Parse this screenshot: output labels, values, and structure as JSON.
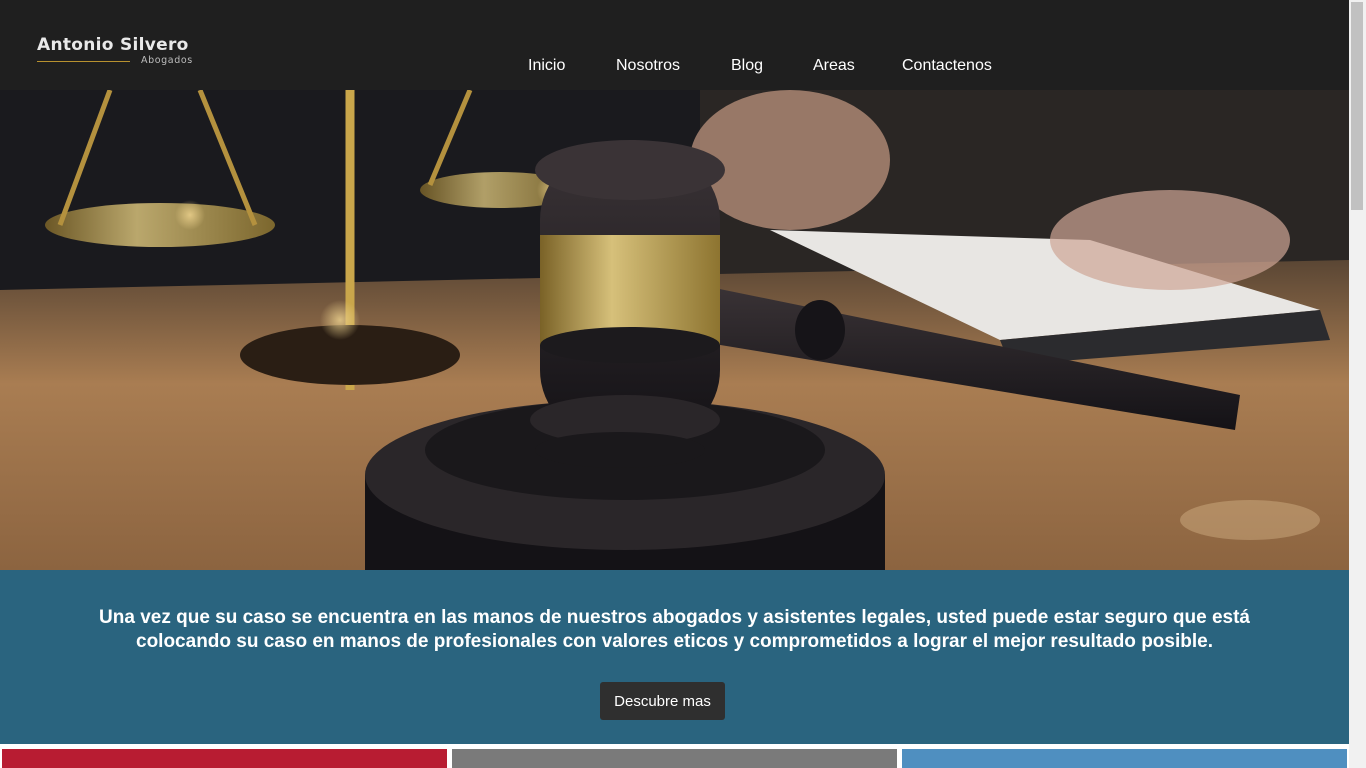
{
  "brand": {
    "name": "Antonio Silvero",
    "tagline": "Abogados"
  },
  "nav": {
    "items": [
      "Inicio",
      "Nosotros",
      "Blog",
      "Areas",
      "Contactenos"
    ]
  },
  "hero": {
    "image": "gavel-and-scales-of-justice"
  },
  "mission": {
    "text": "Una vez que su caso se encuentra en las manos de nuestros abogados y asistentes legales, usted puede estar seguro que está colocando su caso en manos de profesionales con valores eticos y comprometidos a lograr el mejor resultado posible.",
    "cta_label": "Descubre mas"
  },
  "colors": {
    "header_bg": "#1f1f1f",
    "mission_bg": "#2a647f",
    "button_bg": "#2f2f2f",
    "card_red": "#b81c32",
    "card_gray": "#7a7a7a",
    "card_blue": "#4f8fc0"
  }
}
